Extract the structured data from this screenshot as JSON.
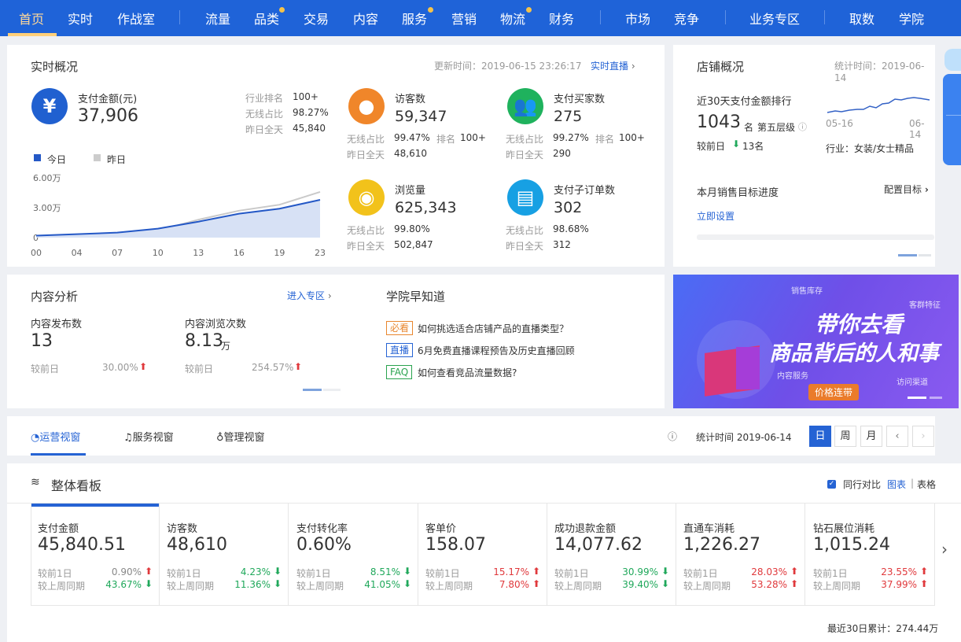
{
  "nav": {
    "items": [
      "首页",
      "实时",
      "作战室",
      "流量",
      "品类",
      "交易",
      "内容",
      "服务",
      "营销",
      "物流",
      "财务",
      "市场",
      "竞争",
      "业务专区",
      "取数",
      "学院"
    ]
  },
  "realtime": {
    "title": "实时概况",
    "update_time": "更新时间：2019-06-15 23:26:17",
    "live_link": "实时直播",
    "pay": {
      "label": "支付金额(元)",
      "value": "37,906",
      "rank_label": "行业排名",
      "rank_value": "100+",
      "wireless_label": "无线占比",
      "wireless_value": "98.27%",
      "yesterday_label": "昨日全天",
      "yesterday_value": "45,840"
    },
    "legend_today": "今日",
    "legend_yesterday": "昨日",
    "visitors": {
      "label": "访客数",
      "value": "59,347",
      "wireless_label": "无线占比",
      "wireless_value": "99.47%",
      "rank_label": "排名",
      "rank_value": "100+",
      "yesterday_label": "昨日全天",
      "yesterday_value": "48,610"
    },
    "buyers": {
      "label": "支付买家数",
      "value": "275",
      "wireless_label": "无线占比",
      "wireless_value": "99.27%",
      "rank_label": "排名",
      "rank_value": "100+",
      "yesterday_label": "昨日全天",
      "yesterday_value": "290"
    },
    "pageviews": {
      "label": "浏览量",
      "value": "625,343",
      "wireless_label": "无线占比",
      "wireless_value": "99.80%",
      "yesterday_label": "昨日全天",
      "yesterday_value": "502,847"
    },
    "suborders": {
      "label": "支付子订单数",
      "value": "302",
      "wireless_label": "无线占比",
      "wireless_value": "98.68%",
      "yesterday_label": "昨日全天",
      "yesterday_value": "312"
    }
  },
  "chart_data": {
    "type": "area",
    "x": [
      "00",
      "04",
      "07",
      "10",
      "13",
      "16",
      "19",
      "23"
    ],
    "y_ticks": [
      "6.00万",
      "3.00万",
      "0"
    ],
    "ylim": [
      0,
      60000
    ],
    "series": [
      {
        "name": "今日",
        "values": [
          2000,
          3500,
          5000,
          9000,
          16000,
          24000,
          29000,
          37906
        ]
      },
      {
        "name": "昨日",
        "values": [
          1500,
          2500,
          3000,
          7000,
          18000,
          27000,
          33000,
          45840
        ]
      }
    ]
  },
  "shop": {
    "title": "店铺概况",
    "stat_time": "统计时间：2019-06-14",
    "rank_title": "近30天支付金额排行",
    "rank_value": "1043",
    "rank_unit": "名",
    "tier": "第五层级",
    "compare_label": "较前日",
    "compare_value": "13名",
    "date_start": "05-16",
    "date_end": "06-14",
    "industry": "行业：女装/女士精品",
    "target_title": "本月销售目标进度",
    "config_target": "配置目标",
    "set_now": "立即设置"
  },
  "content": {
    "title": "内容分析",
    "enter": "进入专区",
    "publish_label": "内容发布数",
    "publish_value": "13",
    "views_label": "内容浏览次数",
    "views_value": "8.13",
    "views_unit": "万",
    "compare_label": "较前日",
    "publish_change": "30.00%",
    "views_change": "254.57%"
  },
  "academy": {
    "title": "学院早知道",
    "items": [
      {
        "tag": "必看",
        "text": "如何挑选适合店铺产品的直播类型？"
      },
      {
        "tag": "直播",
        "text": "6月免费直播课程预告及历史直播回顾"
      },
      {
        "tag": "FAQ",
        "text": "如何查看竞品流量数据?"
      }
    ]
  },
  "banner": {
    "line1": "带你去看",
    "line2": "商品背后的人和事",
    "tags": [
      "销售库存",
      "客群特征",
      "内容服务",
      "访问渠道"
    ],
    "button": "价格连带"
  },
  "views_tabs": {
    "tabs": [
      "运营视窗",
      "服务视窗",
      "管理视窗"
    ],
    "stat_time": "统计时间 2019-06-14",
    "day": "日",
    "week": "周",
    "month": "月"
  },
  "board": {
    "title": "整体看板",
    "compare": "同行对比",
    "chart": "图表",
    "table": "表格",
    "footer": "最近30日累计：274.44万",
    "labels": {
      "prev_day": "较前1日",
      "prev_week": "较上周同期"
    },
    "kpis": [
      {
        "label": "支付金额",
        "value": "45,840.51",
        "d1": "0.90%",
        "w1": "43.67%"
      },
      {
        "label": "访客数",
        "value": "48,610",
        "d1": "4.23%",
        "w1": "11.36%"
      },
      {
        "label": "支付转化率",
        "value": "0.60%",
        "d1": "8.51%",
        "w1": "41.05%"
      },
      {
        "label": "客单价",
        "value": "158.07",
        "d1": "15.17%",
        "w1": "7.80%"
      },
      {
        "label": "成功退款金额",
        "value": "14,077.62",
        "d1": "30.99%",
        "w1": "39.40%"
      },
      {
        "label": "直通车消耗",
        "value": "1,226.27",
        "d1": "28.03%",
        "w1": "53.28%"
      },
      {
        "label": "钻石展位消耗",
        "value": "1,015.24",
        "d1": "23.55%",
        "w1": "37.99%"
      }
    ]
  },
  "colors": {
    "nav": "#1f63d8",
    "accent": "#2563d4",
    "up": "#e0393c",
    "down": "#20a85b"
  }
}
